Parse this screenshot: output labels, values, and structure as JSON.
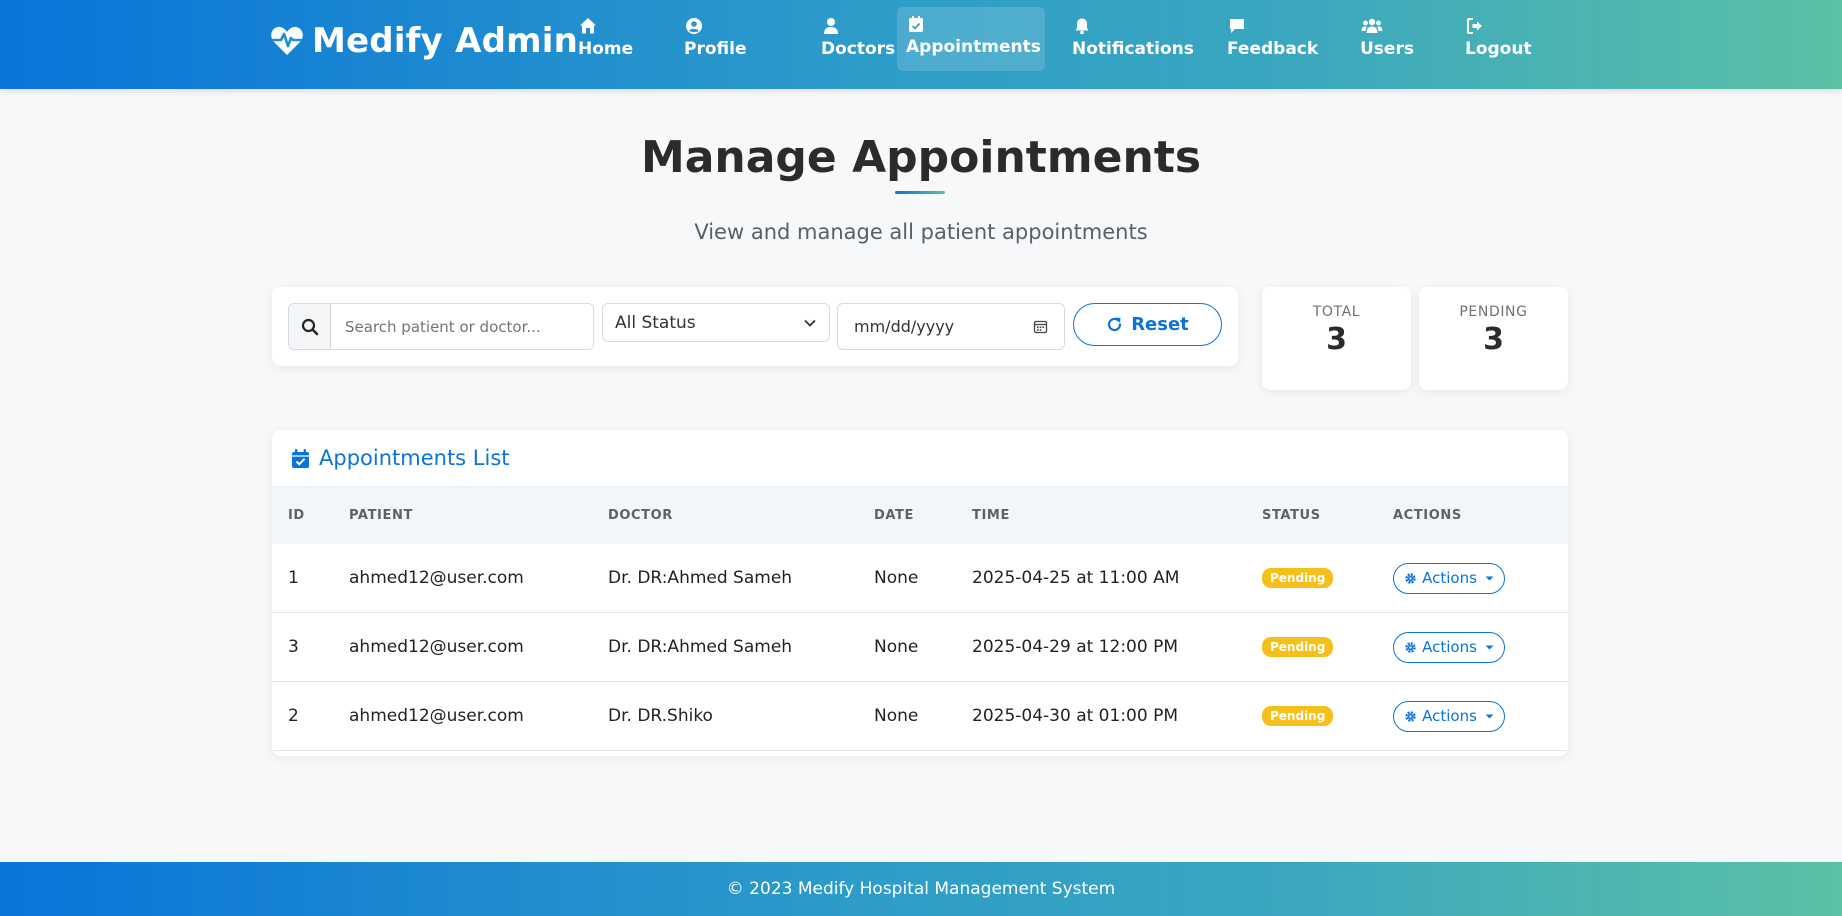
{
  "brand": {
    "name": "Medify Admin"
  },
  "nav": {
    "items": [
      {
        "label": "Home",
        "icon": "home-icon"
      },
      {
        "label": "Profile",
        "icon": "user-circle-icon"
      },
      {
        "label": "Doctors",
        "icon": "doctor-icon"
      },
      {
        "label": "Appointments",
        "icon": "calendar-check-icon",
        "active": true
      },
      {
        "label": "Notifications",
        "icon": "bell-icon"
      },
      {
        "label": "Feedback",
        "icon": "comment-icon"
      },
      {
        "label": "Users",
        "icon": "users-icon"
      },
      {
        "label": "Logout",
        "icon": "logout-icon"
      }
    ]
  },
  "page": {
    "title": "Manage Appointments",
    "subtitle": "View and manage all patient appointments"
  },
  "filters": {
    "search_placeholder": "Search patient or doctor...",
    "status_selected": "All Status",
    "date_placeholder": "mm/dd/yyyy",
    "reset_label": "Reset"
  },
  "stats": {
    "total_label": "TOTAL",
    "total_value": "3",
    "pending_label": "PENDING",
    "pending_value": "3"
  },
  "table": {
    "title": "Appointments List",
    "columns": [
      "ID",
      "PATIENT",
      "DOCTOR",
      "DATE",
      "TIME",
      "STATUS",
      "ACTIONS"
    ],
    "rows": [
      {
        "id": "1",
        "patient": "ahmed12@user.com",
        "doctor": "Dr. DR:Ahmed Sameh",
        "date": "None",
        "time": "2025-04-25 at 11:00 AM",
        "status": "Pending",
        "action": "Actions"
      },
      {
        "id": "3",
        "patient": "ahmed12@user.com",
        "doctor": "Dr. DR:Ahmed Sameh",
        "date": "None",
        "time": "2025-04-29 at 12:00 PM",
        "status": "Pending",
        "action": "Actions"
      },
      {
        "id": "2",
        "patient": "ahmed12@user.com",
        "doctor": "Dr. DR.Shiko",
        "date": "None",
        "time": "2025-04-30 at 01:00 PM",
        "status": "Pending",
        "action": "Actions"
      }
    ]
  },
  "footer": {
    "text": "© 2023 Medify Hospital Management System"
  },
  "colors": {
    "primary": "#0a74da",
    "gradient_end": "#5cc0a5",
    "pending_badge": "#f6bf1a"
  }
}
